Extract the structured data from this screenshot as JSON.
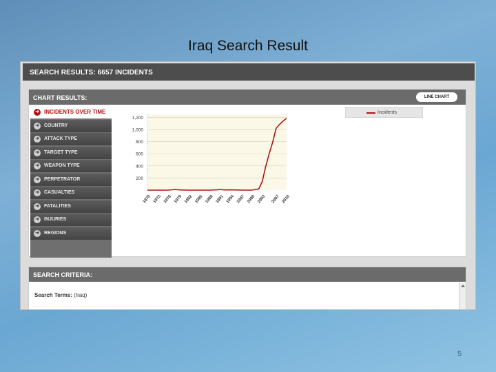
{
  "slide": {
    "title": "Iraq Search Result",
    "page_number": "5"
  },
  "results_header": "SEARCH RESULTS: 6657 INCIDENTS",
  "chart_panel": {
    "title": "CHART RESULTS:",
    "view_button": "LINE CHART"
  },
  "sidebar": {
    "items": [
      {
        "label": "INCIDENTS OVER TIME",
        "active": true
      },
      {
        "label": "COUNTRY"
      },
      {
        "label": "ATTACK TYPE"
      },
      {
        "label": "TARGET TYPE"
      },
      {
        "label": "WEAPON TYPE"
      },
      {
        "label": "PERPETRATOR"
      },
      {
        "label": "CASUALTIES"
      },
      {
        "label": "FATALITIES"
      },
      {
        "label": "INJURIES"
      },
      {
        "label": "REGIONS"
      }
    ]
  },
  "criteria_panel": {
    "title": "SEARCH CRITERIA:",
    "terms_label": "Search Terms:",
    "terms_value": "(Iraq)"
  },
  "colors": {
    "line": "#b01212",
    "header": "#4d4d4d",
    "panel_head": "#6b6b6b"
  },
  "chart_data": {
    "type": "line",
    "title": "",
    "xlabel": "",
    "ylabel": "",
    "x": [
      1970,
      1972,
      1974,
      1976,
      1978,
      1979,
      1980,
      1982,
      1984,
      1986,
      1988,
      1990,
      1991,
      1992,
      1994,
      1996,
      1998,
      2000,
      2002,
      2003,
      2004,
      2005,
      2006,
      2007,
      2008,
      2009,
      2010
    ],
    "series": [
      {
        "name": "Incidents",
        "values": [
          0,
          0,
          0,
          0,
          10,
          5,
          2,
          0,
          0,
          0,
          0,
          5,
          10,
          4,
          5,
          2,
          0,
          0,
          20,
          140,
          390,
          600,
          790,
          1020,
          1085,
          1140,
          1185
        ]
      }
    ],
    "xticks": [
      "1970",
      "1973",
      "1976",
      "1979",
      "1982",
      "1985",
      "1988",
      "1991",
      "1994",
      "1997",
      "2000",
      "2003",
      "2007",
      "2010"
    ],
    "yticks": [
      "200",
      "400",
      "600",
      "800",
      "1,000",
      "1,200"
    ],
    "xlim": [
      1970,
      2010
    ],
    "ylim": [
      0,
      1250
    ],
    "grid": true,
    "legend": "top-right"
  }
}
